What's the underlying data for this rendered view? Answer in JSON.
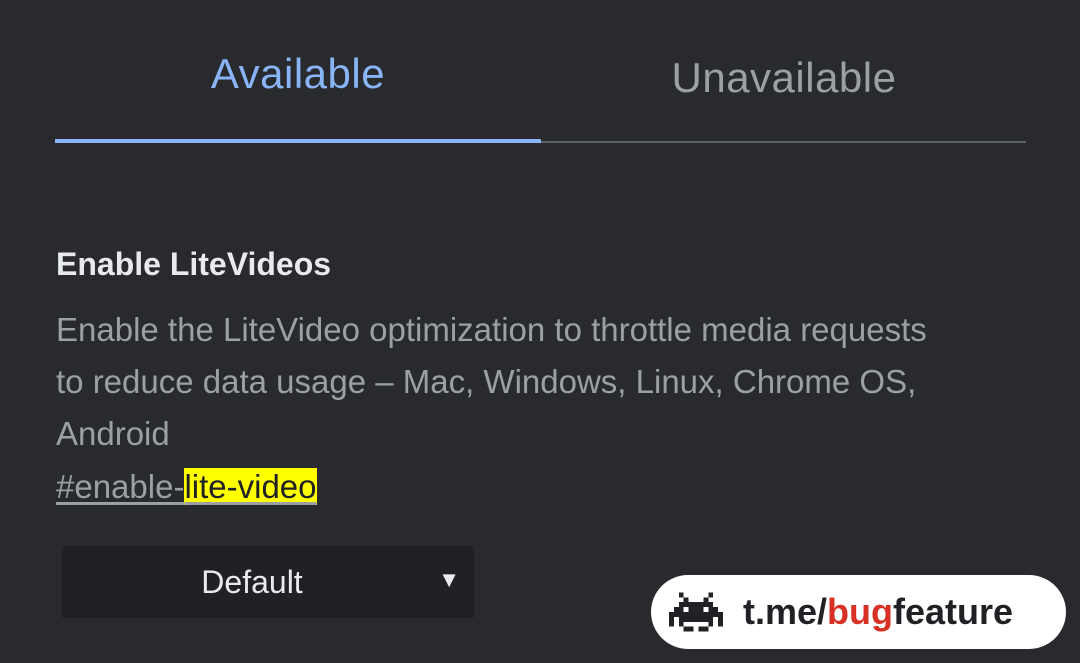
{
  "tabs": {
    "available": "Available",
    "unavailable": "Unavailable"
  },
  "flag": {
    "title": "Enable LiteVideos",
    "description": "Enable the LiteVideo optimization to throttle media requests to reduce data usage – Mac, Windows, Linux, Chrome OS, Android",
    "permalink_prefix": "#enable-",
    "permalink_highlight": "lite-video",
    "selected_option": "Default",
    "dropdown_arrow": "▼"
  },
  "watermark": {
    "text_prefix": "t.me/",
    "text_accent": "bug",
    "text_suffix": "feature",
    "icon": "space-invader-icon"
  },
  "colors": {
    "background": "#292a2d",
    "accent": "#8ab4f8",
    "highlight": "#ffff00",
    "watermark_accent": "#d93025"
  }
}
